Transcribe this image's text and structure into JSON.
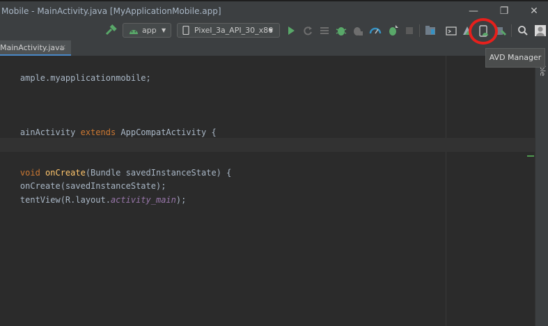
{
  "window": {
    "title": "Mobile - MainActivity.java [MyApplicationMobile.app]",
    "minimize_glyph": "—",
    "restore_glyph": "❐",
    "close_glyph": "✕"
  },
  "toolbar": {
    "run_config": "app",
    "device": "Pixel_3a_API_30_x86",
    "dropdown_glyph": "▼",
    "tooltip": "AVD Manager"
  },
  "tabs": [
    {
      "label": "MainActivity.java",
      "close": "×",
      "active": true
    }
  ],
  "right_strip": {
    "label": "ble"
  },
  "code": {
    "line1": "ample.myapplicationmobile;",
    "line2_name": "ainActivity ",
    "line2_kw": "extends",
    "line2_rest": " AppCompatActivity {",
    "line3_kw": "void ",
    "line3_fn": "onCreate",
    "line3_rest": "(Bundle savedInstanceState) {",
    "line4": "onCreate(savedInstanceState);",
    "line5_pre": "tentView(R.layout.",
    "line5_it": "activity_main",
    "line5_post": ");"
  },
  "icons": [
    "hammer-icon",
    "android-icon",
    "phone-icon",
    "run-icon",
    "rerun-icon",
    "coverage-icon",
    "debug-icon",
    "attach-debugger-icon",
    "profile-icon",
    "apply-changes-icon",
    "stop-icon",
    "project-structure-icon",
    "sync-icon",
    "layout-inspector-icon",
    "avd-manager-icon",
    "sdk-manager-icon",
    "search-icon",
    "account-icon"
  ],
  "colors": {
    "accent_ring": "#e6201c",
    "run_green": "#59a869",
    "keyword": "#cc7832",
    "function": "#ffc66d"
  }
}
